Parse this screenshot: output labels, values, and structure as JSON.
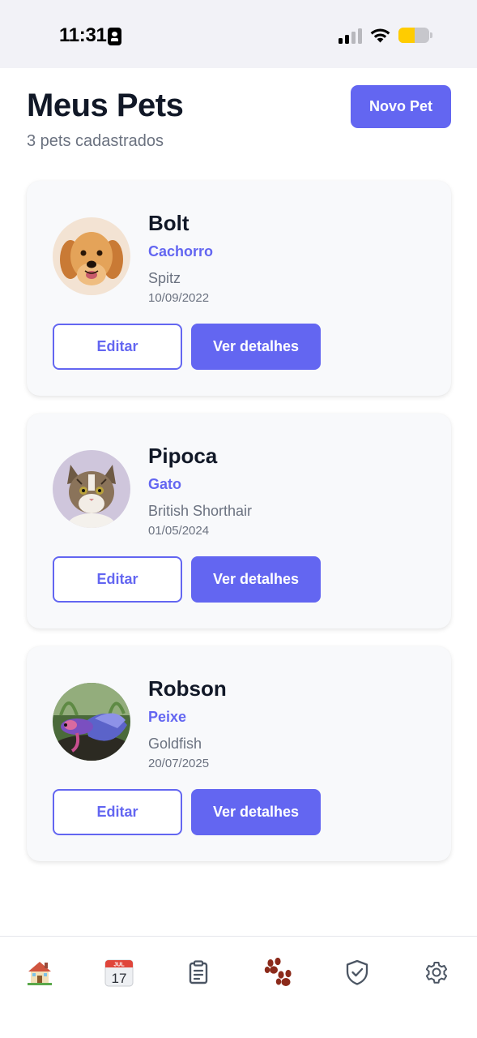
{
  "status_bar": {
    "time": "11:31"
  },
  "header": {
    "title": "Meus Pets",
    "subtitle": "3 pets cadastrados",
    "new_pet_label": "Novo Pet"
  },
  "pets": [
    {
      "name": "Bolt",
      "species": "Cachorro",
      "breed": "Spitz",
      "date": "10/09/2022",
      "avatar": "dog-photo",
      "edit_label": "Editar",
      "details_label": "Ver detalhes"
    },
    {
      "name": "Pipoca",
      "species": "Gato",
      "breed": "British Shorthair",
      "date": "01/05/2024",
      "avatar": "cat-photo",
      "edit_label": "Editar",
      "details_label": "Ver detalhes"
    },
    {
      "name": "Robson",
      "species": "Peixe",
      "breed": "Goldfish",
      "date": "20/07/2025",
      "avatar": "fish-photo",
      "edit_label": "Editar",
      "details_label": "Ver detalhes"
    }
  ],
  "tab_bar": {
    "calendar_month": "JUL",
    "calendar_day": "17",
    "items": [
      {
        "icon": "house-icon"
      },
      {
        "icon": "calendar-icon"
      },
      {
        "icon": "clipboard-icon"
      },
      {
        "icon": "paw-icon",
        "active": true
      },
      {
        "icon": "shield-check-icon"
      },
      {
        "icon": "gear-icon"
      }
    ]
  },
  "colors": {
    "accent": "#6366f1",
    "title": "#111827",
    "muted": "#6b7280",
    "card_bg": "#f8f9fb",
    "paw_active": "#8b2a1a"
  }
}
